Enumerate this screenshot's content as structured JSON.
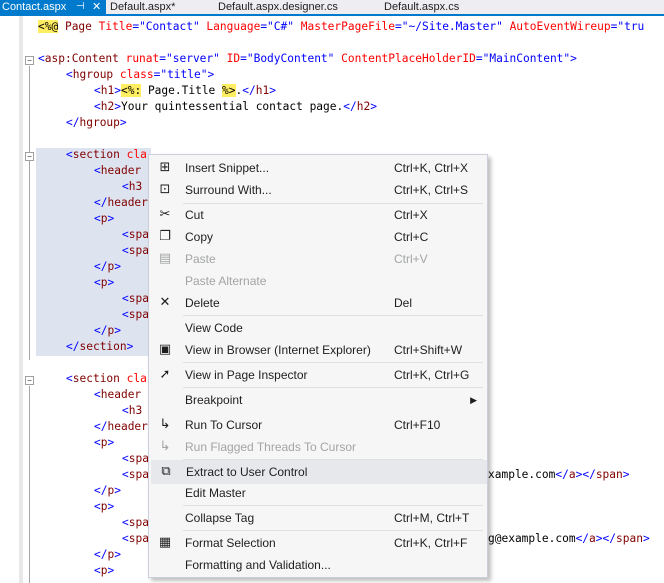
{
  "tabs": [
    {
      "label": "Contact.aspx",
      "active": true
    },
    {
      "label": "Default.aspx*",
      "active": false
    },
    {
      "label": "Default.aspx.designer.cs",
      "active": false
    },
    {
      "label": "Default.aspx.cs",
      "active": false
    }
  ],
  "tab_icons": {
    "pin": "pin-icon",
    "close": "close-icon"
  },
  "code": {
    "l1": {
      "dir_open": "<%@",
      "tag": " Page ",
      "a1": "Title",
      "v1": "=\"Contact\"",
      "a2": " Language",
      "v2": "=\"C#\"",
      "a3": " MasterPageFile",
      "v3": "=\"~/Site.Master\"",
      "a4": " AutoEventWireup",
      "v4": "=\"tru"
    },
    "l2": {
      "b1": "<",
      "tag": "asp:Content",
      "a1": " runat",
      "v1": "=\"server\"",
      "a2": " ID",
      "v2": "=\"BodyContent\"",
      "a3": " ContentPlaceHolderID",
      "v3": "=\"MainContent\"",
      "b2": ">"
    },
    "l3": {
      "b1": "<",
      "tag": "hgroup",
      "a1": " class",
      "v1": "=\"title\"",
      "b2": ">"
    },
    "l4": {
      "b1": "<",
      "tag": "h1",
      "b2": ">",
      "d1": "<%:",
      "text": " Page.Title ",
      "d2": "%>",
      "t2": ".",
      "b3": "</",
      "tag2": "h1",
      "b4": ">"
    },
    "l5": {
      "b1": "<",
      "tag": "h2",
      "b2": ">",
      "text": "Your quintessential contact page.",
      "b3": "</",
      "tag2": "h2",
      "b4": ">"
    },
    "l6": {
      "b1": "</",
      "tag": "hgroup",
      "b2": ">"
    },
    "l7": {
      "b1": "<",
      "tag": "section",
      "a1": " cla"
    },
    "l8": {
      "b1": "<",
      "tag": "header"
    },
    "l9": {
      "b1": "<",
      "tag": "h3"
    },
    "l10": {
      "b1": "</",
      "tag": "header"
    },
    "l11": {
      "b1": "<",
      "tag": "p",
      "b2": ">"
    },
    "l12": {
      "b1": "<",
      "tag": "spa"
    },
    "l13": {
      "b1": "<",
      "tag": "spa"
    },
    "l14": {
      "b1": "</",
      "tag": "p",
      "b2": ">"
    },
    "l15": {
      "b1": "<",
      "tag": "p",
      "b2": ">"
    },
    "l16": {
      "b1": "<",
      "tag": "spa"
    },
    "l17": {
      "b1": "<",
      "tag": "spa"
    },
    "l18": {
      "b1": "</",
      "tag": "p",
      "b2": ">"
    },
    "l19": {
      "b1": "</",
      "tag": "section",
      "b2": ">"
    },
    "l20": {
      "b1": "<",
      "tag": "section",
      "a1": " cla"
    },
    "l21": {
      "b1": "<",
      "tag": "header"
    },
    "l22": {
      "b1": "<",
      "tag": "h3"
    },
    "l23": {
      "b1": "</",
      "tag": "header"
    },
    "l24": {
      "b1": "<",
      "tag": "p",
      "b2": ">"
    },
    "l25": {
      "b1": "<",
      "tag": "spa"
    },
    "l26": {
      "b1": "<",
      "tag": "spa",
      "tail_text": "xample.com",
      "tb1": "</",
      "tt1": "a",
      "tb2": "></",
      "tt2": "span",
      "tb3": ">"
    },
    "l27": {
      "b1": "</",
      "tag": "p",
      "b2": ">"
    },
    "l28": {
      "b1": "<",
      "tag": "p",
      "b2": ">"
    },
    "l29": {
      "b1": "<",
      "tag": "spa"
    },
    "l30": {
      "b1": "<",
      "tag": "spa",
      "tail_text": "g@example.com",
      "tb1": "</",
      "tt1": "a",
      "tb2": "></",
      "tt2": "span",
      "tb3": ">"
    },
    "l31": {
      "b1": "</",
      "tag": "p",
      "b2": ">"
    },
    "l32": {
      "b1": "<",
      "tag": "p",
      "b2": ">"
    }
  },
  "context_menu": {
    "items": [
      {
        "label": "Insert Snippet...",
        "shortcut": "Ctrl+K, Ctrl+X",
        "icon": "insert-snippet-icon",
        "enabled": true
      },
      {
        "label": "Surround With...",
        "shortcut": "Ctrl+K, Ctrl+S",
        "icon": "surround-with-icon",
        "enabled": true
      },
      {
        "label": "Cut",
        "shortcut": "Ctrl+X",
        "icon": "scissors-icon",
        "enabled": true
      },
      {
        "label": "Copy",
        "shortcut": "Ctrl+C",
        "icon": "copy-icon",
        "enabled": true
      },
      {
        "label": "Paste",
        "shortcut": "Ctrl+V",
        "icon": "paste-icon",
        "enabled": false
      },
      {
        "label": "Paste Alternate",
        "shortcut": "",
        "icon": "",
        "enabled": false
      },
      {
        "label": "Delete",
        "shortcut": "Del",
        "icon": "delete-x-icon",
        "enabled": true
      },
      {
        "label": "View Code",
        "shortcut": "",
        "icon": "",
        "enabled": true
      },
      {
        "label": "View in Browser (Internet Explorer)",
        "shortcut": "Ctrl+Shift+W",
        "icon": "browser-icon",
        "enabled": true
      },
      {
        "label": "View in Page Inspector",
        "shortcut": "Ctrl+K, Ctrl+G",
        "icon": "cursor-arrow-icon",
        "enabled": true
      },
      {
        "label": "Breakpoint",
        "shortcut": "",
        "icon": "",
        "enabled": true,
        "submenu": true
      },
      {
        "label": "Run To Cursor",
        "shortcut": "Ctrl+F10",
        "icon": "run-to-cursor-icon",
        "enabled": true
      },
      {
        "label": "Run Flagged Threads To Cursor",
        "shortcut": "",
        "icon": "run-flagged-threads-icon",
        "enabled": false
      },
      {
        "label": "Extract to User Control",
        "shortcut": "",
        "icon": "extract-user-control-icon",
        "enabled": true,
        "highlighted": true
      },
      {
        "label": "Edit Master",
        "shortcut": "",
        "icon": "",
        "enabled": true
      },
      {
        "label": "Collapse Tag",
        "shortcut": "Ctrl+M, Ctrl+T",
        "icon": "",
        "enabled": true
      },
      {
        "label": "Format Selection",
        "shortcut": "Ctrl+K, Ctrl+F",
        "icon": "format-selection-icon",
        "enabled": true
      },
      {
        "label": "Formatting and Validation...",
        "shortcut": "",
        "icon": "",
        "enabled": true
      }
    ],
    "submenu_arrow_icon": "submenu-arrow-icon"
  },
  "colors": {
    "accent": "#007acc",
    "tag": "#800000",
    "attribute": "#ff0000",
    "value": "#0000ff",
    "directive_bg": "#ffee62",
    "selection": "#dde4f0"
  }
}
